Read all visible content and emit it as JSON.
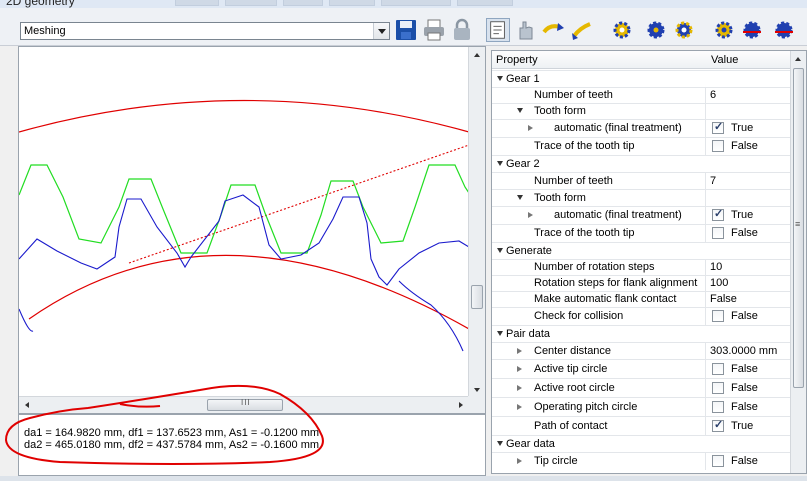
{
  "window": {
    "title": "2D geometry"
  },
  "toolbar": {
    "view_selected": "Meshing",
    "icons": [
      "save-icon",
      "print-icon",
      "lock-icon",
      "properties-icon",
      "hand-icon",
      "zoom-in-icon",
      "zoom-out-icon",
      "gear-icon",
      "gear-icon",
      "gear-icon",
      "gear-icon",
      "gear-icon"
    ]
  },
  "drawing": {
    "colors": {
      "tip_circle": "#e00000",
      "gear1": "#22cc22",
      "gear2": "#1a1acc",
      "line_of_action": "#e00000"
    },
    "hscroll_grip": "III"
  },
  "results": {
    "line1": "da1 = 164.9820 mm, df1 = 137.6523 mm, As1 = -0.1200 mm",
    "line2": "da2 = 465.0180 mm, df2 = 437.5784 mm, As2 = -0.1600 mm"
  },
  "grid": {
    "header_property": "Property",
    "header_value": "Value",
    "rows": [
      {
        "label": "Gear 1",
        "level": 0,
        "expander": "down",
        "value": "",
        "check": null
      },
      {
        "label": "Number of teeth",
        "level": 1,
        "expander": null,
        "value": "6",
        "check": null
      },
      {
        "label": "Tooth form",
        "level": 1,
        "expander": "down",
        "value": "",
        "check": null
      },
      {
        "label": "automatic (final treatment)",
        "level": 2,
        "expander": "right",
        "value": "True",
        "check": true
      },
      {
        "label": "Trace of the tooth tip",
        "level": 1,
        "expander": null,
        "value": "False",
        "check": false
      },
      {
        "label": "Gear 2",
        "level": 0,
        "expander": "down",
        "value": "",
        "check": null
      },
      {
        "label": "Number of teeth",
        "level": 1,
        "expander": null,
        "value": "7",
        "check": null
      },
      {
        "label": "Tooth form",
        "level": 1,
        "expander": "down",
        "value": "",
        "check": null
      },
      {
        "label": "automatic (final treatment)",
        "level": 2,
        "expander": "right",
        "value": "True",
        "check": true
      },
      {
        "label": "Trace of the tooth tip",
        "level": 1,
        "expander": null,
        "value": "False",
        "check": false
      },
      {
        "label": "Generate",
        "level": 0,
        "expander": "down",
        "value": "",
        "check": null
      },
      {
        "label": "Number of rotation steps",
        "level": 1,
        "expander": null,
        "value": "10",
        "check": null
      },
      {
        "label": "Rotation steps for flank alignment",
        "level": 1,
        "expander": null,
        "value": "100",
        "check": null
      },
      {
        "label": "Make automatic flank contact",
        "level": 1,
        "expander": null,
        "value": "False",
        "check": null
      },
      {
        "label": "Check for collision",
        "level": 1,
        "expander": null,
        "value": "False",
        "check": false
      },
      {
        "label": "Pair data",
        "level": 0,
        "expander": "down",
        "value": "",
        "check": null
      },
      {
        "label": "Center distance",
        "level": 1,
        "expander": "right",
        "value": "303.0000 mm",
        "check": null
      },
      {
        "label": "Active tip circle",
        "level": 1,
        "expander": "right",
        "value": "False",
        "check": false
      },
      {
        "label": "Active root circle",
        "level": 1,
        "expander": "right",
        "value": "False",
        "check": false
      },
      {
        "label": "Operating pitch circle",
        "level": 1,
        "expander": "right",
        "value": "False",
        "check": false
      },
      {
        "label": "Path of contact",
        "level": 1,
        "expander": null,
        "value": "True",
        "check": true
      },
      {
        "label": "Gear data",
        "level": 0,
        "expander": "down",
        "value": "",
        "check": null
      },
      {
        "label": "Tip circle",
        "level": 1,
        "expander": "right",
        "value": "False",
        "check": false
      }
    ]
  }
}
